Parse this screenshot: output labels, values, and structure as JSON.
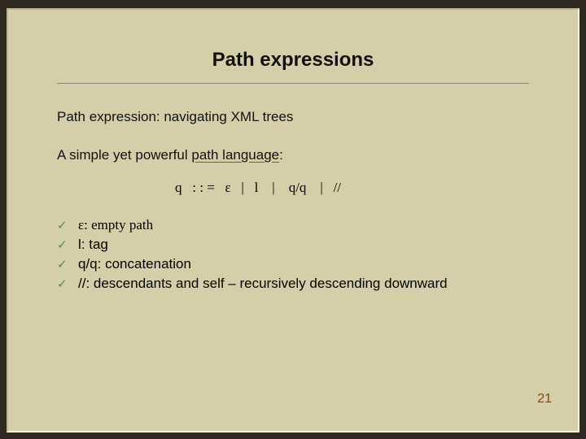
{
  "title": "Path expressions",
  "line1": "Path expression: navigating XML trees",
  "line2_prefix": "A simple yet powerful ",
  "line2_underlined": "path language",
  "line2_suffix": ":",
  "grammar": "q   : : =   ε   |   l    |    q/q    |   //",
  "bullets": [
    "ε:  empty path",
    "l:  tag",
    "q/q:  concatenation",
    "//:  descendants and self – recursively descending downward"
  ],
  "check_glyph": "✓",
  "page_number": "21"
}
